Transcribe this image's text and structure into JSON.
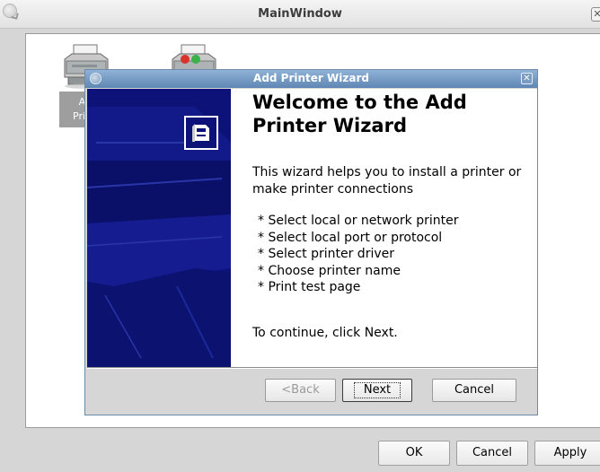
{
  "main_window": {
    "title": "MainWindow",
    "printer_label": "Ad Prin",
    "buttons": {
      "ok": "OK",
      "cancel": "Cancel",
      "apply": "Apply"
    }
  },
  "wizard": {
    "title": "Add Printer Wizard",
    "heading": "Welcome to the Add Printer Wizard",
    "intro": "This  wizard helps you to install a printer or make printer connections",
    "steps": [
      "* Select local or network printer",
      "* Select local port or protocol",
      "* Select printer driver",
      "* Choose printer name",
      "* Print test page"
    ],
    "continue_text": "To continue, click Next.",
    "buttons": {
      "back": "<Back",
      "next": "Next",
      "cancel": "Cancel"
    },
    "colors": {
      "side_panel": "#0c1278",
      "titlebar": "#6f93bd"
    }
  }
}
